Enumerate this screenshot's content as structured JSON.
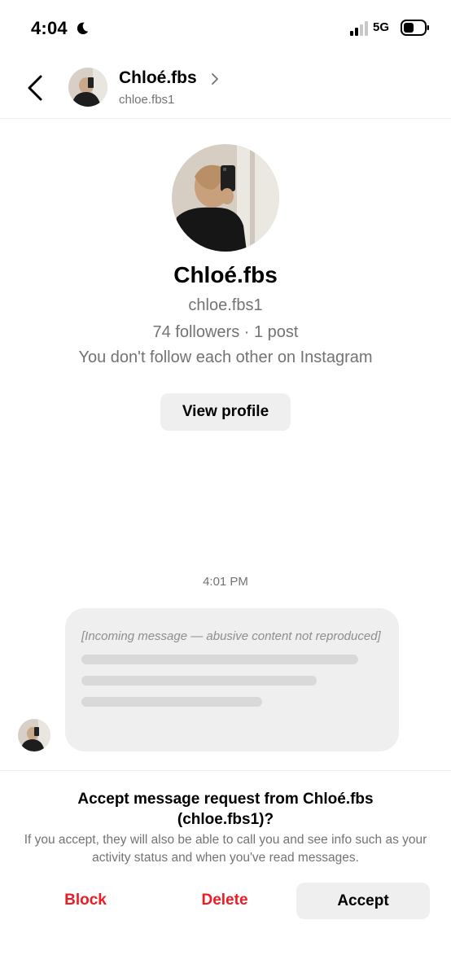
{
  "status_bar": {
    "time": "4:04",
    "network": "5G",
    "icons": [
      "moon-icon",
      "signal-icon",
      "battery-icon"
    ]
  },
  "header": {
    "display_name": "Chloé.fbs",
    "username": "chloe.fbs1",
    "icons": [
      "back-arrow-icon",
      "chevron-right-icon"
    ]
  },
  "profile": {
    "display_name": "Chloé.fbs",
    "username": "chloe.fbs1",
    "stats": "74 followers · 1 post",
    "follow_status": "You don't follow each other on Instagram",
    "view_profile_label": "View profile"
  },
  "conversation": {
    "timestamp": "4:01 PM",
    "message_placeholder": "[Incoming message — abusive content not reproduced]"
  },
  "request": {
    "title": "Accept message request from Chloé.fbs (chloe.fbs1)?",
    "info": "If you accept, they will also be able to call you and see info such as your activity status and when you've read messages.",
    "block_label": "Block",
    "delete_label": "Delete",
    "accept_label": "Accept"
  },
  "colors": {
    "destructive": "#ed1c24",
    "secondary_text": "#737373",
    "button_bg": "#efefef"
  }
}
